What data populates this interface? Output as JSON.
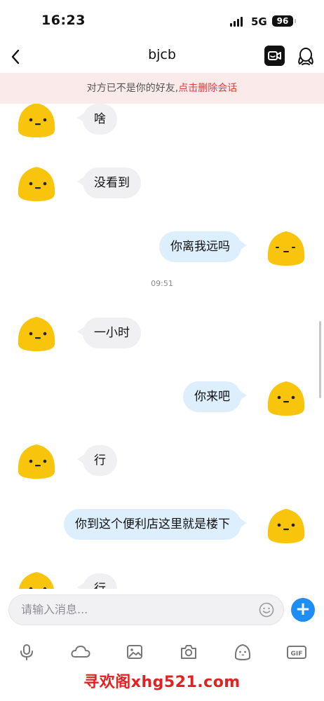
{
  "status_bar": {
    "time": "16:23",
    "network": "5G",
    "battery": "96"
  },
  "header": {
    "title": "bjcb"
  },
  "notice": {
    "text": "对方已不是你的好友,",
    "link": "点击删除会话"
  },
  "messages": [
    {
      "side": "in",
      "text": "啥"
    },
    {
      "side": "in",
      "text": "没看到"
    },
    {
      "side": "out",
      "text": "你离我远吗"
    },
    {
      "side": "in",
      "text": "一小时"
    },
    {
      "side": "out",
      "text": "你来吧"
    },
    {
      "side": "in",
      "text": "行"
    },
    {
      "side": "out",
      "text": "你到这个便利店这里就是楼下"
    },
    {
      "side": "in",
      "text": "行"
    }
  ],
  "timestamp": "09:51",
  "input": {
    "placeholder": "请输入消息..."
  },
  "toolbar": {
    "items": [
      "microphone-icon",
      "cloud-icon",
      "image-icon",
      "camera-icon",
      "sticker-icon",
      "gif-icon"
    ],
    "gif_label": "GIF"
  },
  "watermark": "寻欢阁xhg521.com",
  "colors": {
    "accent": "#1e8ef5",
    "notice_link": "#e43d3d",
    "out_bubble": "#ddeffd",
    "in_bubble": "#f0f0f2",
    "avatar": "#f8c40c"
  }
}
